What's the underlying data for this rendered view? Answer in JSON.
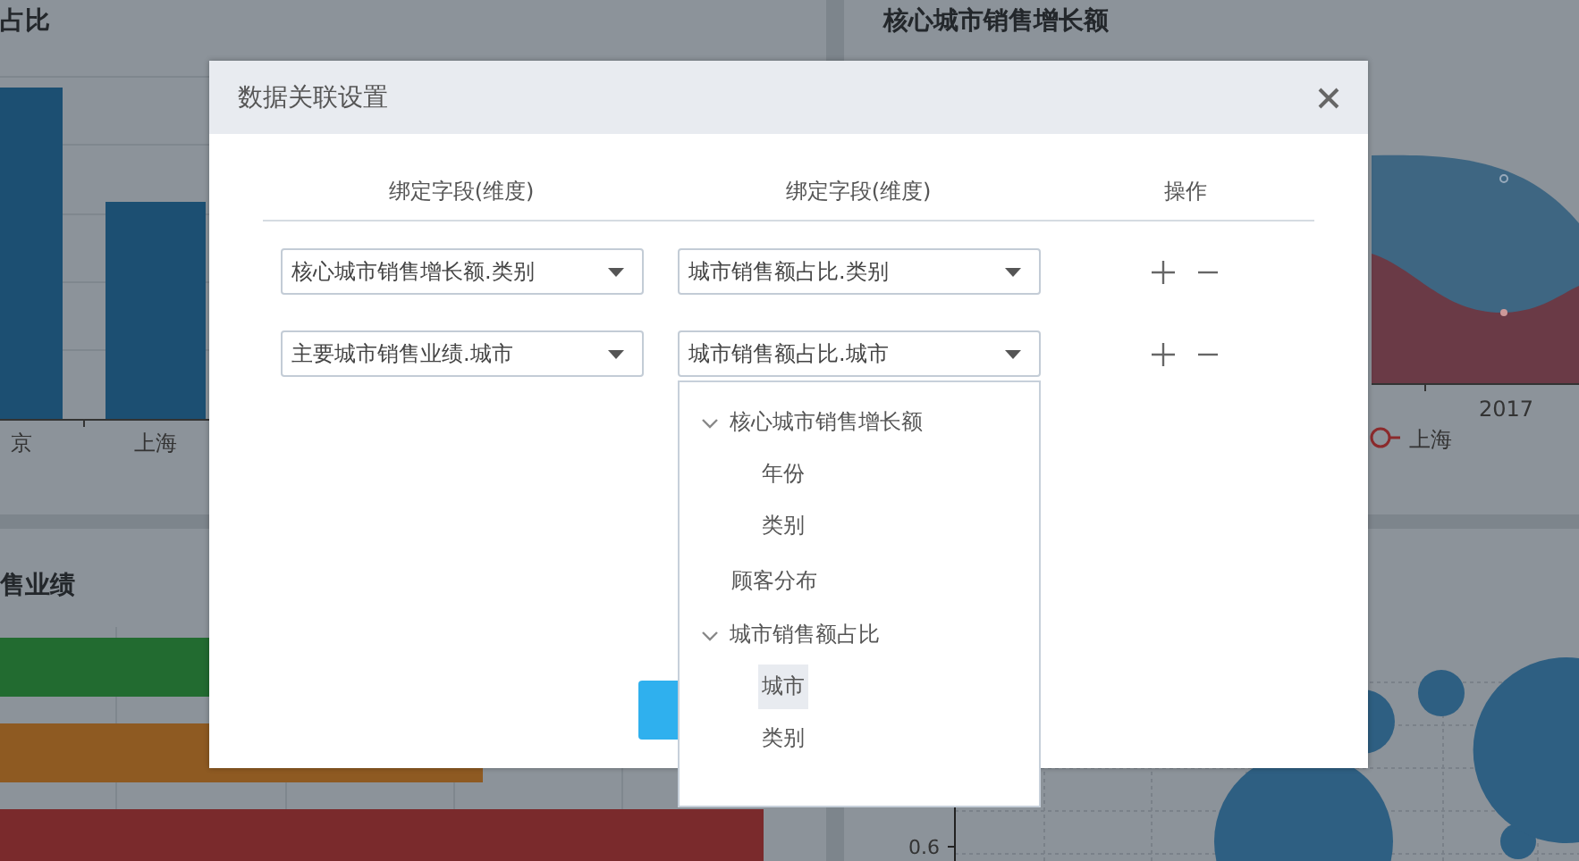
{
  "dashboard": {
    "panels": [
      {
        "kind": "bar",
        "title": "占比",
        "labels": [
          "京",
          "上海"
        ]
      },
      {
        "kind": "area",
        "title": "核心城市销售增长额",
        "labels": [
          "2017"
        ],
        "legend": [
          "上海"
        ]
      },
      {
        "kind": "hbar",
        "title": "售业绩"
      },
      {
        "kind": "bubble",
        "labels": [
          "0.6"
        ]
      }
    ]
  },
  "dialog": {
    "title": "数据关联设置",
    "columns": [
      "绑定字段(维度)",
      "绑定字段(维度)",
      "操作"
    ],
    "rows": [
      {
        "source": "核心城市销售增长额.类别",
        "target": "城市销售额占比.类别"
      },
      {
        "source": "主要城市销售业绩.城市",
        "target": "城市销售额占比.城市",
        "dropdown": {
          "items": [
            {
              "label": "核心城市销售增长额",
              "expanded": true,
              "children": [
                {
                  "label": "年份",
                  "selected": false
                },
                {
                  "label": "类别",
                  "selected": false
                }
              ]
            },
            {
              "label": "顾客分布",
              "selected": false
            },
            {
              "label": "城市销售额占比",
              "expanded": true,
              "children": [
                {
                  "label": "城市",
                  "selected": true
                },
                {
                  "label": "类别",
                  "selected": false
                }
              ]
            }
          ]
        }
      }
    ]
  }
}
